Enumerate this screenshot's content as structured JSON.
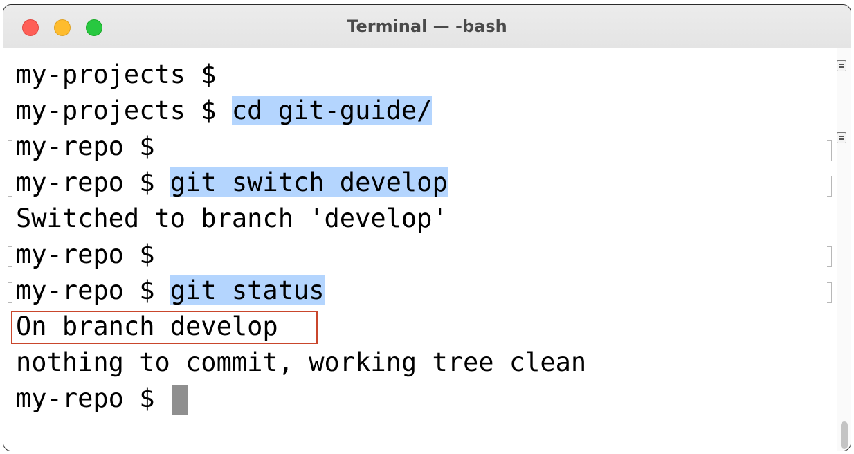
{
  "window": {
    "title": "Terminal — -bash"
  },
  "terminal": {
    "lines": [
      {
        "prompt": "my-projects $ ",
        "command": ""
      },
      {
        "prompt": "my-projects $ ",
        "command": "cd git-guide/"
      },
      {
        "prompt": "my-repo $ ",
        "command": ""
      },
      {
        "prompt": "my-repo $ ",
        "command": "git switch develop"
      },
      {
        "output": "Switched to branch 'develop'"
      },
      {
        "prompt": "my-repo $ ",
        "command": ""
      },
      {
        "prompt": "my-repo $ ",
        "command": "git status"
      },
      {
        "output": "On branch develop"
      },
      {
        "output": "nothing to commit, working tree clean"
      },
      {
        "prompt": "my-repo $ ",
        "command": ""
      }
    ]
  },
  "colors": {
    "selection": "#b4d5fe",
    "highlight_box": "#c9462c",
    "close": "#fe5f57",
    "minimize": "#febc2e",
    "zoom": "#28c840"
  },
  "icons": {
    "close": "close-button-icon",
    "minimize": "minimize-button-icon",
    "zoom": "zoom-button-icon",
    "mark": "mark-icon"
  }
}
